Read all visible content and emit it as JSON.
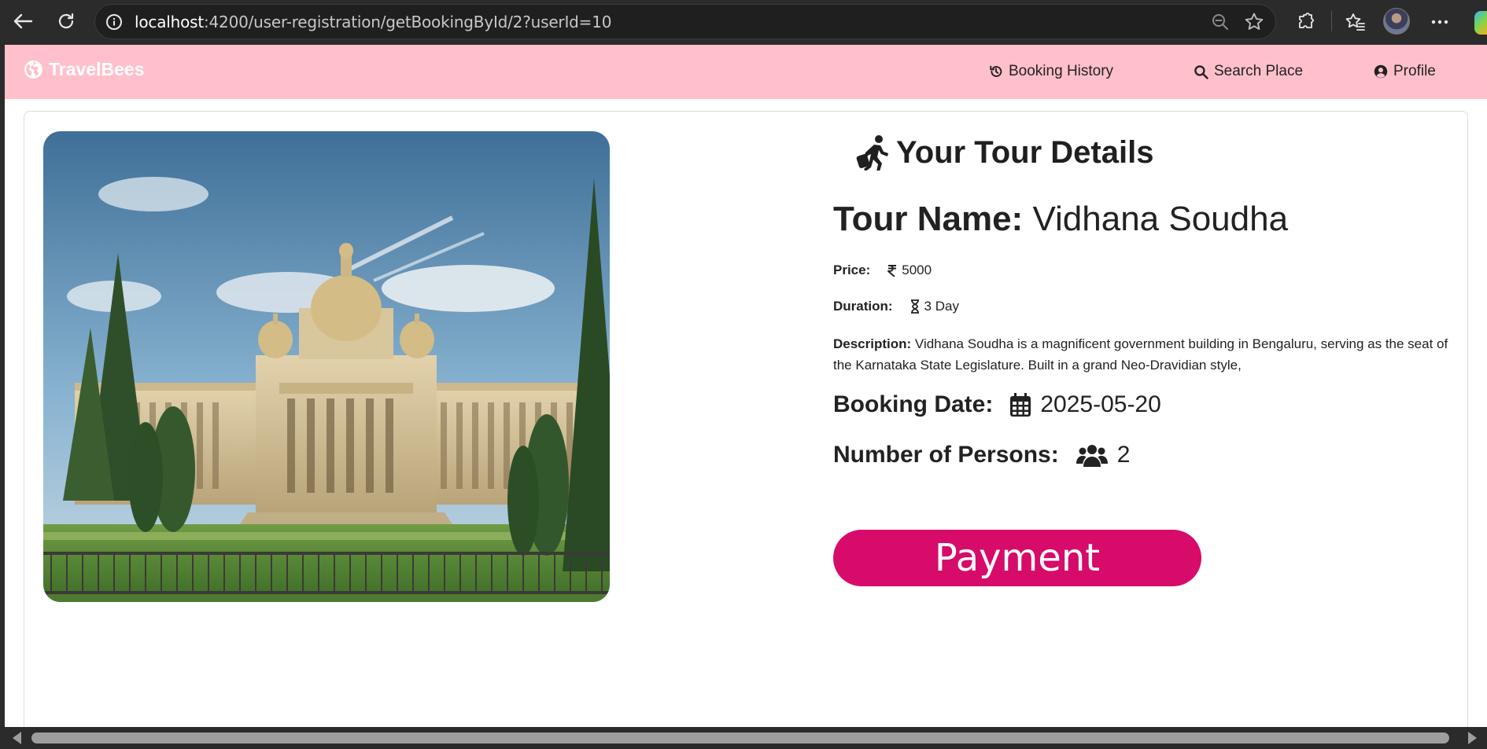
{
  "browser": {
    "url_host": "localhost",
    "url_rest": ":4200/user-registration/getBookingById/2?userId=10"
  },
  "navbar": {
    "brand": "TravelBees",
    "links": [
      {
        "label": "Booking History",
        "icon": "history-icon"
      },
      {
        "label": "Search Place",
        "icon": "search-icon"
      },
      {
        "label": "Profile",
        "icon": "user-circle-icon"
      }
    ],
    "background": "#ffc0cb"
  },
  "details": {
    "heading": "Your Tour Details",
    "tour_name_label": "Tour Name:",
    "tour_name": "Vidhana Soudha",
    "price_label": "Price:",
    "price": "5000",
    "duration_label": "Duration:",
    "duration": "3 Day",
    "description_label": "Description:",
    "description": "Vidhana Soudha is a magnificent government building in Bengaluru, serving as the seat of the Karnataka State Legislature. Built in a grand Neo-Dravidian style,",
    "booking_date_label": "Booking Date:",
    "booking_date": "2025-05-20",
    "persons_label": "Number of Persons:",
    "persons": "2",
    "payment_button": "Payment",
    "payment_color": "#d60b6a"
  }
}
